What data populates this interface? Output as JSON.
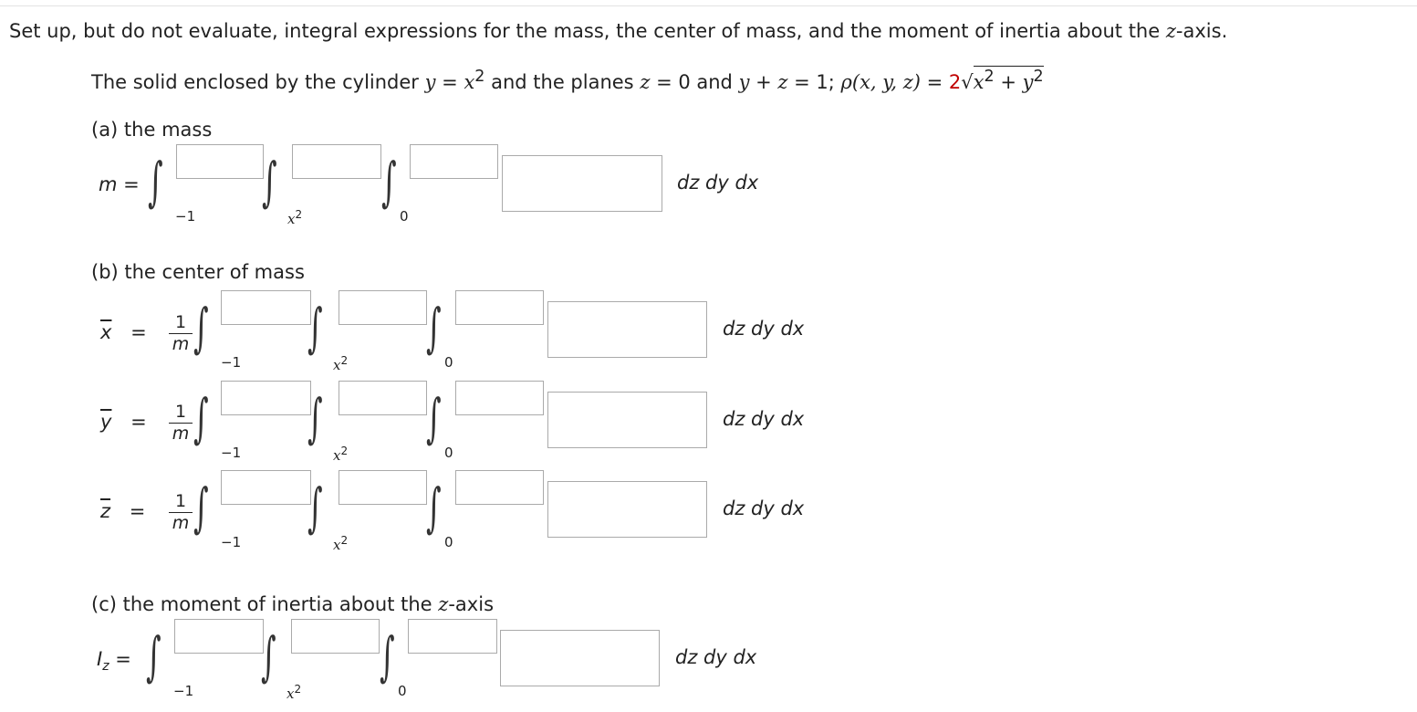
{
  "prompt": {
    "prefix": "Set up, but do not evaluate, integral expressions for the mass, the center of mass, and the moment of inertia about the ",
    "axis": "z",
    "suffix": "-axis."
  },
  "problem": {
    "t1": "The solid enclosed by the cylinder ",
    "t2": "y",
    "t3": " = ",
    "t4": "x",
    "t5": "2",
    "t6": " and the planes ",
    "t7": "z",
    "t8": " = 0 and ",
    "t9": "y",
    "t10": " + ",
    "t11": "z",
    "t12": " = 1; ",
    "t13": "ρ(x, y, z)",
    "t14": " = ",
    "t15": "2",
    "t16a": "x",
    "t16b": "2",
    "t16c": " + ",
    "t16d": "y",
    "t16e": "2"
  },
  "parts": {
    "a_label": "(a) the mass",
    "b_label": "(b) the center of mass",
    "c_label_prefix": "(c) the moment of inertia about the ",
    "c_label_axis": "z",
    "c_label_suffix": "-axis"
  },
  "lhs": {
    "m": "m",
    "eq": "=",
    "xbar": "x",
    "ybar": "y",
    "zbar": "z",
    "iz_main": "I",
    "iz_sub": "z",
    "frac_num": "1",
    "frac_den": "m"
  },
  "integral": {
    "symbol": "∫",
    "lower1": "−1",
    "lower2_base": "x",
    "lower2_exp": "2",
    "lower3": "0",
    "differentials": "dz dy dx"
  },
  "inputs": {
    "a": [
      "",
      "",
      "",
      ""
    ],
    "bx": [
      "",
      "",
      "",
      ""
    ],
    "by": [
      "",
      "",
      "",
      ""
    ],
    "bz": [
      "",
      "",
      "",
      ""
    ],
    "c": [
      "",
      "",
      "",
      ""
    ]
  }
}
